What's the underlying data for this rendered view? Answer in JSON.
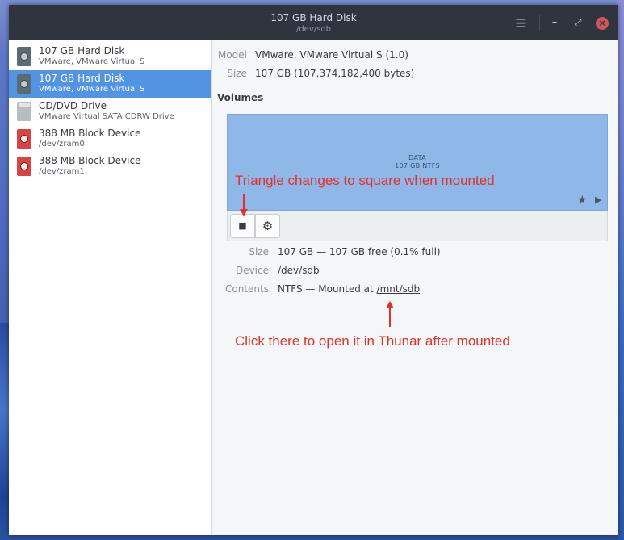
{
  "window": {
    "title": "107 GB Hard Disk",
    "subtitle": "/dev/sdb",
    "menu_icon": "hamburger-menu-icon",
    "minimize_icon": "minimize-icon",
    "maximize_icon": "maximize-icon",
    "close_icon": "close-icon"
  },
  "devices": [
    {
      "name": "107 GB Hard Disk",
      "sub": "VMware, VMware Virtual S",
      "icon": "hard-disk-icon",
      "selected": false
    },
    {
      "name": "107 GB Hard Disk",
      "sub": "VMware, VMware Virtual S",
      "icon": "hard-disk-icon",
      "selected": true
    },
    {
      "name": "CD/DVD Drive",
      "sub": "VMware Virtual SATA CDRW Drive",
      "icon": "optical-drive-icon",
      "selected": false
    },
    {
      "name": "388 MB Block Device",
      "sub": "/dev/zram0",
      "icon": "block-device-icon",
      "selected": false
    },
    {
      "name": "388 MB Block Device",
      "sub": "/dev/zram1",
      "icon": "block-device-icon",
      "selected": false
    }
  ],
  "disk": {
    "model_label": "Model",
    "model_value": "VMware, VMware Virtual S (1.0)",
    "size_label": "Size",
    "size_value": "107 GB (107,374,182,400 bytes)"
  },
  "volumes": {
    "title": "Volumes",
    "partition_name": "DATA",
    "partition_sub": "107 GB NTFS",
    "graph_color": "#8fb8e8",
    "stop_icon": "■",
    "gear_icon": "⚙",
    "star_icon": "★",
    "play_icon": "▶"
  },
  "volume_info": {
    "size_label": "Size",
    "size_value": "107 GB — 107 GB free (0.1% full)",
    "device_label": "Device",
    "device_value": "/dev/sdb",
    "contents_label": "Contents",
    "contents_prefix": "NTFS — Mounted at ",
    "mount_path": "/mnt/sdb"
  },
  "annotations": {
    "mount_note": "Triangle changes to square when mounted",
    "open_note": "Click there to open it in Thunar after mounted",
    "color": "#e2302a"
  }
}
